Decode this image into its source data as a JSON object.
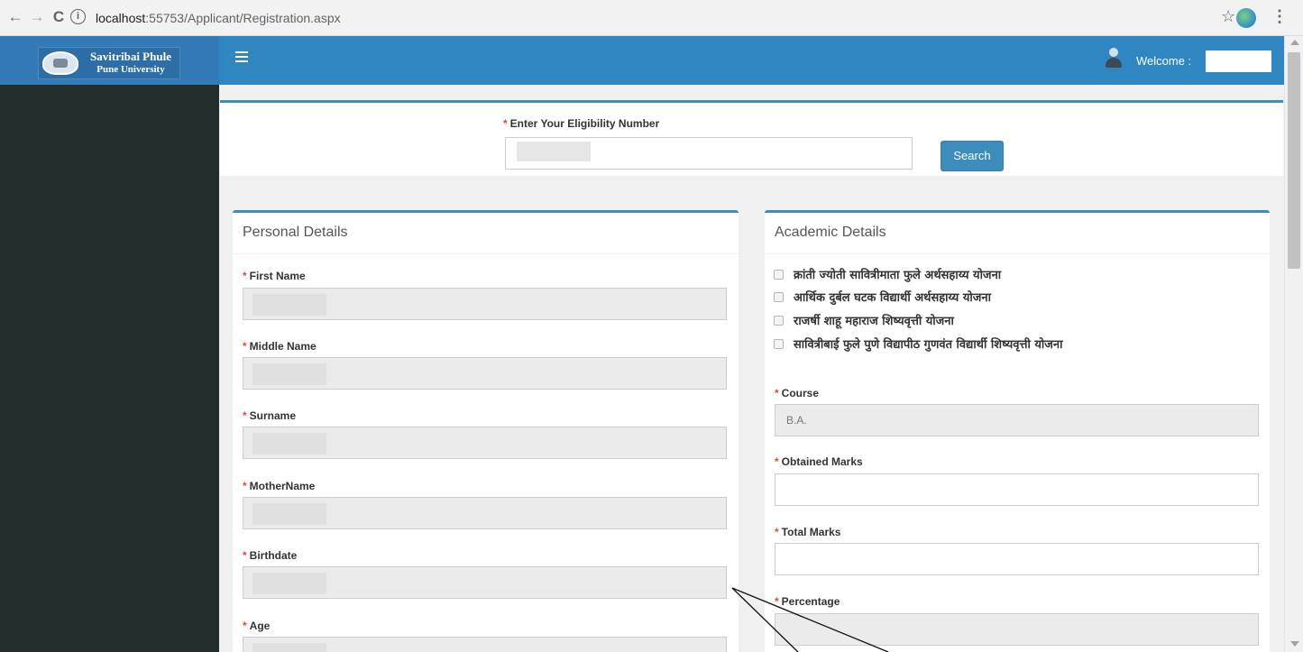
{
  "browser": {
    "url_host": "localhost",
    "url_rest": ":55753/Applicant/Registration.aspx",
    "back_icon": "←",
    "forward_icon": "→",
    "reload_icon": "C",
    "info_icon": "i",
    "star_icon": "☆",
    "menu_icon": "⋮"
  },
  "brand": {
    "line1": "Savitribai Phule",
    "line2": "Pune University"
  },
  "header": {
    "welcome_label": "Welcome :",
    "welcome_value": ""
  },
  "eligibility": {
    "label": "Enter Your Eligibility Number",
    "value": "",
    "search_label": "Search"
  },
  "personal": {
    "title": "Personal Details",
    "fields": [
      {
        "label": "First Name",
        "value": ""
      },
      {
        "label": "Middle Name",
        "value": ""
      },
      {
        "label": "Surname",
        "value": ""
      },
      {
        "label": "MotherName",
        "value": ""
      },
      {
        "label": "Birthdate",
        "value": ""
      },
      {
        "label": "Age",
        "value": ""
      }
    ]
  },
  "academic": {
    "title": "Academic Details",
    "schemes": [
      "क्रांती ज्योती सावित्रीमाता फुले अर्थसहाय्य योजना",
      "आर्थिक दुर्बल घटक विद्यार्थी अर्थसहाय्य योजना",
      "राजर्षी शाहू महाराज शिष्यवृत्ती योजना",
      "सावित्रीबाई फुले पुणे विद्यापीठ गुणवंत विद्यार्थी शिष्यवृत्ती योजना"
    ],
    "course_label": "Course",
    "course_value": "B.A.",
    "obtained_label": "Obtained Marks",
    "obtained_value": "",
    "total_label": "Total Marks",
    "total_value": "",
    "percentage_label": "Percentage",
    "percentage_value": ""
  },
  "colors": {
    "header_blue": "#2f86c0",
    "brand_blue": "#337ab7",
    "sidebar_dark": "#222d2c",
    "button_blue": "#3c8dbc",
    "required_red": "#dd4b39"
  }
}
